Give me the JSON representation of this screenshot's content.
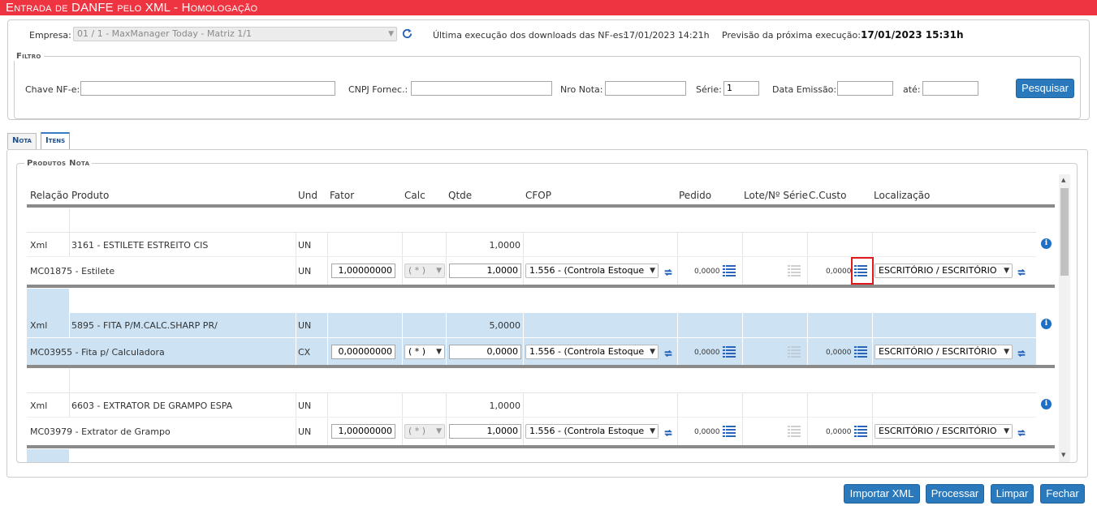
{
  "title": "Entrada de DANFE pelo XML  - Homologação",
  "header": {
    "empresa_label": "Empresa:",
    "empresa_value": "01 / 1 - MaxManager Today - Matriz 1/1",
    "ultima_label": "Última execução dos downloads das NF-es:",
    "ultima_value": "17/01/2023 14:21h",
    "previsao_label": "Previsão da próxima execução:",
    "previsao_value": "17/01/2023 15:31h"
  },
  "filtro": {
    "legend": "Filtro",
    "chave_label": "Chave NF-e:",
    "chave_value": "",
    "cnpj_label": "CNPJ Fornec.:",
    "cnpj_value": "",
    "nro_label": "Nro Nota:",
    "nro_value": "",
    "serie_label": "Série:",
    "serie_value": "1",
    "data_label": "Data Emissão:",
    "data_value": "",
    "ate_label": "até:",
    "ate_value": "",
    "pesquisar_label": "Pesquisar"
  },
  "tabs": [
    {
      "label": "Nota"
    },
    {
      "label": "Itens"
    }
  ],
  "produtos": {
    "legend": "Produtos Nota",
    "columns": [
      "Relação",
      "Produto",
      "Und",
      "Fator",
      "Calc",
      "Qtde",
      "CFOP",
      "Pedido",
      "Lote/Nº Série",
      "C.Custo",
      "Localização"
    ],
    "items": [
      {
        "xml": {
          "relacao": "Xml",
          "produto": "3161 - ESTILETE ESTREITO CIS",
          "und": "UN",
          "qtde": "1,0000"
        },
        "mc": {
          "relacao": "MC01875 - Estilete",
          "und": "UN",
          "fator": "1,00000000",
          "calc": "( * )",
          "qtde": "1,0000",
          "cfop": "1.556 - (Controla Estoque",
          "pedido": "0,0000",
          "ccusto": "0,0000",
          "localizacao": "ESCRITÓRIO / ESCRITÓRIO"
        }
      },
      {
        "xml": {
          "relacao": "Xml",
          "produto": "5895 - FITA P/M.CALC.SHARP PR/",
          "und": "UN",
          "qtde": "5,0000"
        },
        "mc": {
          "relacao": "MC03955 - Fita p/ Calculadora",
          "und": "CX",
          "fator": "0,00000000",
          "calc": "( * )",
          "qtde": "0,0000",
          "cfop": "1.556 - (Controla Estoque",
          "pedido": "0,0000",
          "ccusto": "0,0000",
          "localizacao": "ESCRITÓRIO / ESCRITÓRIO"
        }
      },
      {
        "xml": {
          "relacao": "Xml",
          "produto": "6603 - EXTRATOR DE GRAMPO ESPA",
          "und": "UN",
          "qtde": "1,0000"
        },
        "mc": {
          "relacao": "MC03979 - Extrator de Grampo",
          "und": "UN",
          "fator": "1,00000000",
          "calc": "( * )",
          "qtde": "1,0000",
          "cfop": "1.556 - (Controla Estoque",
          "pedido": "0,0000",
          "ccusto": "0,0000",
          "localizacao": "ESCRITÓRIO / ESCRITÓRIO"
        }
      }
    ]
  },
  "footer": {
    "importar": "Importar XML",
    "processar": "Processar",
    "limpar": "Limpar",
    "fechar": "Fechar"
  },
  "colors": {
    "title_bar": "#ee3440",
    "button": "#2a79bc",
    "selected_row": "#cde3f4",
    "highlight": "#e01a1a"
  },
  "icons": {
    "refresh": "refresh-icon",
    "list": "list-icon",
    "sync": "sync-icon",
    "info": "info-icon"
  }
}
